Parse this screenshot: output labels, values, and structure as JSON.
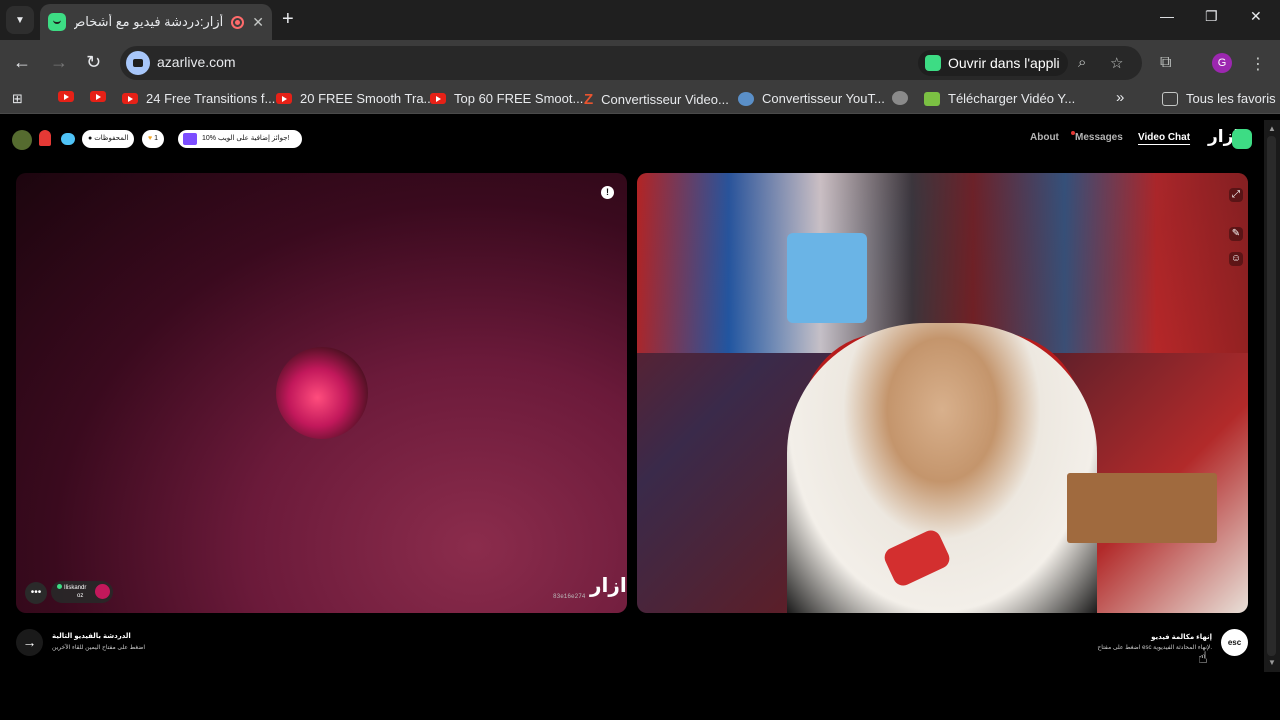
{
  "browser": {
    "tab_title": "أزار:دردشة فيديو مع أشخاص",
    "url": "azarlive.com",
    "open_in_app": "Ouvrir dans l'appli",
    "profile_initial": "G"
  },
  "bookmarks": {
    "items": [
      {
        "label": "24 Free Transitions f..."
      },
      {
        "label": "20 FREE Smooth Tra..."
      },
      {
        "label": "Top 60 FREE Smoot..."
      },
      {
        "label": "Convertisseur Video..."
      },
      {
        "label": "Convertisseur YouT..."
      },
      {
        "label": "Télécharger Vidéo Y..."
      }
    ],
    "overflow": "»",
    "all_bookmarks": "Tous les favoris"
  },
  "site": {
    "logo": "ازار",
    "nav": {
      "about": "About",
      "messages": "Messages",
      "video_chat": "Video Chat"
    },
    "pill_gift": "10% جوائز إضافية على الويب!",
    "pill_count": "1",
    "pill_saved": "المحفوظات"
  },
  "left_panel": {
    "watermark_id": "83e16e274",
    "username": "Iliskandr",
    "user_sub": "oz"
  },
  "bottom": {
    "next_title": "الدردشة بالفيديو التالية",
    "next_sub": "اضغط على مفتاح اليمين للقاء الآخرين",
    "end_title": "إنهاء مكالمة فيديو",
    "end_sub": "اضغط على مفتاح esc لإنهاء المحادثة الفيديوية.",
    "esc_label": "esc"
  },
  "colors": {
    "brand": "#3ddc84",
    "page_bg": "#000000"
  }
}
